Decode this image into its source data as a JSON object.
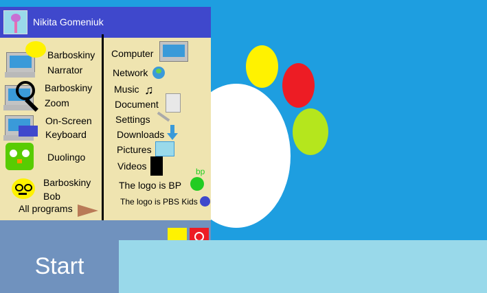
{
  "user": {
    "name": "Nikita Gomeniuk"
  },
  "left_items": [
    {
      "label_1": "Barboskiny",
      "label_2": "Narrator",
      "icon": "computer-speech-icon"
    },
    {
      "label_1": "Barboskiny",
      "label_2": "Zoom",
      "icon": "magnifier-icon"
    },
    {
      "label_1": "On-Screen",
      "label_2": "Keyboard",
      "icon": "keyboard-icon"
    },
    {
      "label_1": "Duolingo",
      "icon": "owl-icon"
    },
    {
      "label_1": "Barboskiny",
      "label_2": "Bob",
      "icon": "smiley-glasses-icon"
    }
  ],
  "all_programs": "All programs",
  "right_items": [
    {
      "label": "Computer",
      "icon": "monitor-icon"
    },
    {
      "label": "Network",
      "icon": "globe-icon"
    },
    {
      "label": "Music",
      "icon": "music-note-icon"
    },
    {
      "label": "Document",
      "icon": "document-icon"
    },
    {
      "label": "Settings",
      "icon": "wrench-icon"
    },
    {
      "label": "Downloads",
      "icon": "download-arrow-icon"
    },
    {
      "label": "Pictures",
      "icon": "picture-icon"
    },
    {
      "label": "Videos",
      "icon": "film-icon"
    },
    {
      "label": "The logo is BP",
      "icon": "bp-logo-icon",
      "badge": "bp"
    },
    {
      "label": "The logo is PBS Kids",
      "icon": "pbs-kids-icon"
    }
  ],
  "taskbar": {
    "start_label": "Start"
  },
  "colors": {
    "header": "#3f48cc",
    "menu_bg": "#efe4b0",
    "desktop": "#1e9ee0",
    "taskbar": "#99d9ea",
    "start": "#7092be"
  }
}
